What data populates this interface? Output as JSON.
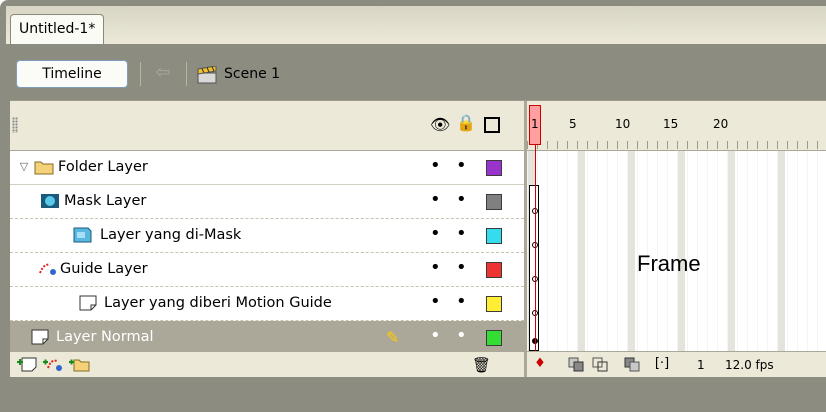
{
  "document_tab": {
    "title": "Untitled-1*"
  },
  "toolbar": {
    "timeline_label": "Timeline",
    "scene_label": "Scene 1",
    "back_icon": "back-arrow-icon",
    "scene_icon": "clapperboard-icon"
  },
  "header": {
    "eye_icon": "eye-icon",
    "lock_icon": "lock-icon",
    "outline_icon": "outline-icon"
  },
  "layers": [
    {
      "label": "Folder Layer",
      "icon": "folder-icon",
      "type": "folder",
      "color": "#9933cc"
    },
    {
      "label": "Mask Layer",
      "icon": "mask-layer-icon",
      "type": "mask",
      "color": "#808080"
    },
    {
      "label": "Layer yang di-Mask",
      "icon": "masked-layer-icon",
      "type": "masked",
      "color": "#33ddee"
    },
    {
      "label": "Guide Layer",
      "icon": "guide-layer-icon",
      "type": "guide",
      "color": "#ee3333"
    },
    {
      "label": "Layer yang diberi Motion Guide",
      "icon": "guided-layer-icon",
      "type": "guided",
      "color": "#ffee33"
    },
    {
      "label": "Layer Normal",
      "icon": "normal-layer-icon",
      "type": "normal",
      "color": "#33dd33",
      "selected": true
    }
  ],
  "ruler": {
    "numbers": [
      "1",
      "5",
      "10",
      "15",
      "20"
    ]
  },
  "frames": {
    "label": "Frame"
  },
  "status": {
    "current_frame": "1",
    "frame_rate": "12.0 fps"
  }
}
